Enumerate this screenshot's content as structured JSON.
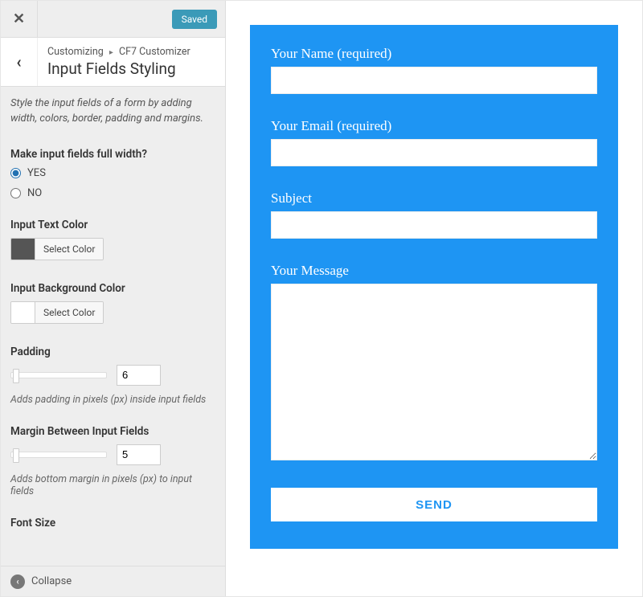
{
  "topbar": {
    "saved_label": "Saved"
  },
  "header": {
    "breadcrumb_root": "Customizing",
    "breadcrumb_leaf": "CF7 Customizer",
    "panel_title": "Input Fields Styling"
  },
  "description": "Style the input fields of a form by adding width, colors, border, padding and margins.",
  "controls": {
    "full_width": {
      "label": "Make input fields full width?",
      "option_yes": "YES",
      "option_no": "NO",
      "value": "YES"
    },
    "text_color": {
      "label": "Input Text Color",
      "button": "Select Color",
      "swatch": "#555555"
    },
    "bg_color": {
      "label": "Input Background Color",
      "button": "Select Color",
      "swatch": "#ffffff"
    },
    "padding": {
      "label": "Padding",
      "value": "6",
      "help": "Adds padding in pixels (px) inside input fields"
    },
    "margin": {
      "label": "Margin Between Input Fields",
      "value": "5",
      "help": "Adds bottom margin in pixels (px) to input fields"
    },
    "font_size": {
      "label": "Font Size"
    }
  },
  "footer": {
    "collapse_label": "Collapse"
  },
  "form": {
    "name_label": "Your Name (required)",
    "email_label": "Your Email (required)",
    "subject_label": "Subject",
    "message_label": "Your Message",
    "send_label": "SEND",
    "accent": "#1e95f3"
  }
}
